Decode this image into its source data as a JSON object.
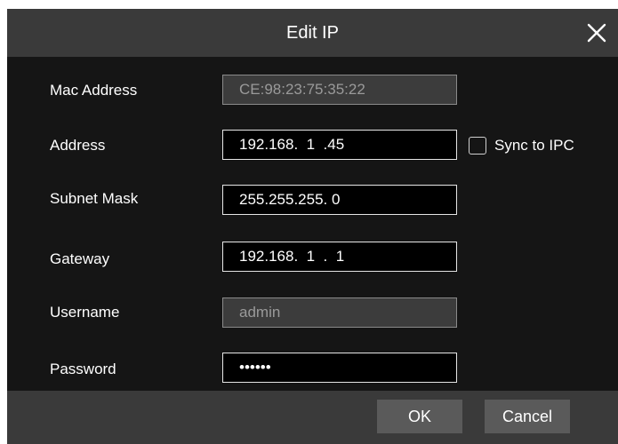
{
  "dialog": {
    "title": "Edit IP",
    "close_icon": "close-icon"
  },
  "fields": {
    "mac": {
      "label": "Mac Address",
      "value": "CE:98:23:75:35:22"
    },
    "address": {
      "label": "Address",
      "value": "192.168.  1  .45"
    },
    "subnet": {
      "label": "Subnet Mask",
      "value": "255.255.255. 0"
    },
    "gateway": {
      "label": "Gateway",
      "value": "192.168.  1  .  1"
    },
    "username": {
      "label": "Username",
      "value": "admin"
    },
    "password": {
      "label": "Password",
      "value": "••••••"
    }
  },
  "sync": {
    "label": "Sync to IPC",
    "checked": false
  },
  "buttons": {
    "ok": "OK",
    "cancel": "Cancel"
  },
  "colors": {
    "dialog_bg": "#151515",
    "bar_bg": "#3a3a3a",
    "button_bg": "#5a5a5a"
  }
}
